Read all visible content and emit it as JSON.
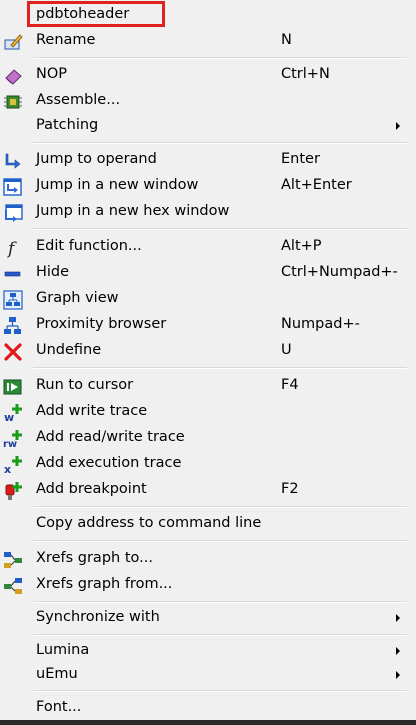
{
  "menu": {
    "items": [
      {
        "label": "pdbtoheader",
        "shortcut": "",
        "icon": "none"
      },
      {
        "label": "Rename",
        "shortcut": "N",
        "icon": "rename-icon"
      },
      {
        "label": "NOP",
        "shortcut": "Ctrl+N",
        "icon": "eraser-icon"
      },
      {
        "label": "Assemble...",
        "shortcut": "",
        "icon": "chip-icon"
      },
      {
        "label": "Patching",
        "shortcut": "",
        "icon": "none",
        "submenu": true
      },
      {
        "label": "Jump to operand",
        "shortcut": "Enter",
        "icon": "jump-arrow-icon"
      },
      {
        "label": "Jump in a new window",
        "shortcut": "Alt+Enter",
        "icon": "jump-window-icon"
      },
      {
        "label": "Jump in a new hex window",
        "shortcut": "",
        "icon": "jump-hex-window-icon"
      },
      {
        "label": "Edit function...",
        "shortcut": "Alt+P",
        "icon": "function-icon"
      },
      {
        "label": "Hide",
        "shortcut": "Ctrl+Numpad+-",
        "icon": "minus-icon"
      },
      {
        "label": "Graph view",
        "shortcut": "",
        "icon": "graph-icon"
      },
      {
        "label": "Proximity browser",
        "shortcut": "Numpad+-",
        "icon": "tree-icon"
      },
      {
        "label": "Undefine",
        "shortcut": "U",
        "icon": "red-x-icon"
      },
      {
        "label": "Run to cursor",
        "shortcut": "F4",
        "icon": "run-icon"
      },
      {
        "label": "Add write trace",
        "shortcut": "",
        "icon": "write-trace-icon"
      },
      {
        "label": "Add read/write trace",
        "shortcut": "",
        "icon": "read-write-trace-icon"
      },
      {
        "label": "Add execution trace",
        "shortcut": "",
        "icon": "execution-trace-icon"
      },
      {
        "label": "Add breakpoint",
        "shortcut": "F2",
        "icon": "breakpoint-icon"
      },
      {
        "label": "Copy address to command line",
        "shortcut": "",
        "icon": "none"
      },
      {
        "label": "Xrefs graph to...",
        "shortcut": "",
        "icon": "xrefs-to-icon"
      },
      {
        "label": "Xrefs graph from...",
        "shortcut": "",
        "icon": "xrefs-from-icon"
      },
      {
        "label": "Synchronize with",
        "shortcut": "",
        "icon": "none",
        "submenu": true
      },
      {
        "label": "Lumina",
        "shortcut": "",
        "icon": "none",
        "submenu": true
      },
      {
        "label": "uEmu",
        "shortcut": "",
        "icon": "none",
        "submenu": true
      },
      {
        "label": "Font...",
        "shortcut": "",
        "icon": "none"
      }
    ]
  },
  "colors": {
    "highlight": "#e0211f",
    "background": "#f0f0f0",
    "accent_blue": "#1f5fc8"
  }
}
